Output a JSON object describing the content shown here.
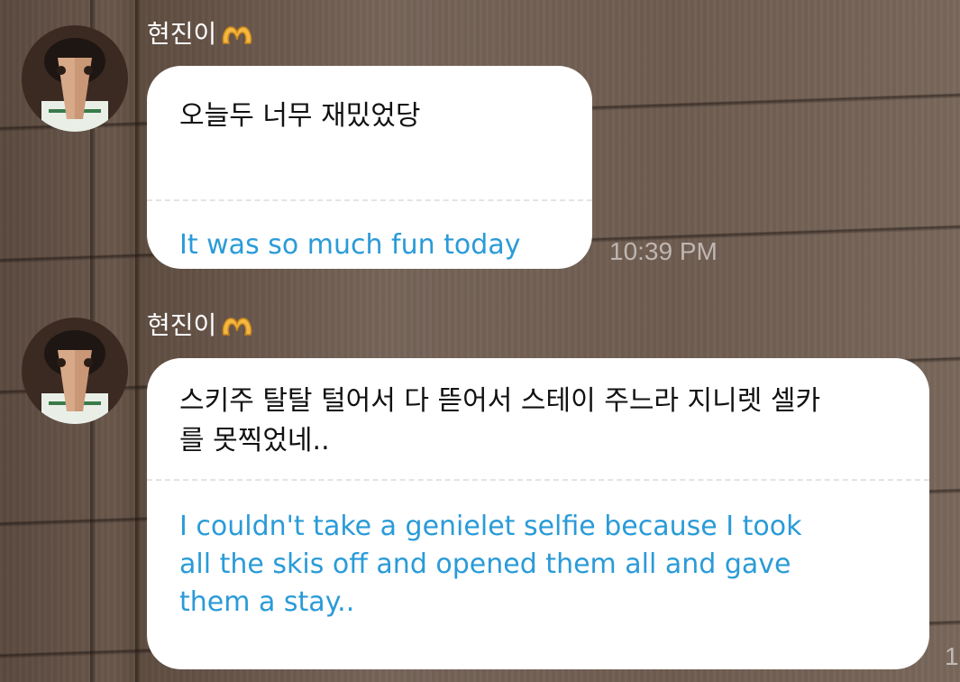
{
  "chat": {
    "messages": [
      {
        "sender": "현진이",
        "original": "오늘두 너무 재밌었당",
        "translation": "It was so much fun today",
        "time": "10:39 PM"
      },
      {
        "sender": "현진이",
        "original": "스키주 탈탈 털어서 다 뜯어서 스테이 주느라 지니렛 셀카를 못찍었네..",
        "original_line1": "스키주 탈탈 털어서 다 뜯어서 스테이 주느라 지니렛 셀카",
        "original_line2": "를 못찍었네..",
        "translation": "I couldn't take a genielet selfie because I took all the skis off and opened them all and gave them a stay..",
        "translation_line1": "I couldn't take a genielet selfie because I took",
        "translation_line2": "all the skis off and opened them all and gave",
        "translation_line3": "them a stay..",
        "time_partial": "1"
      }
    ]
  },
  "colors": {
    "translation_text": "#2a9bd8",
    "bubble_bg": "#ffffff",
    "timestamp": "#c9c0b8"
  },
  "icons": {
    "sender_badge": "heart-hands-emoji-icon"
  }
}
